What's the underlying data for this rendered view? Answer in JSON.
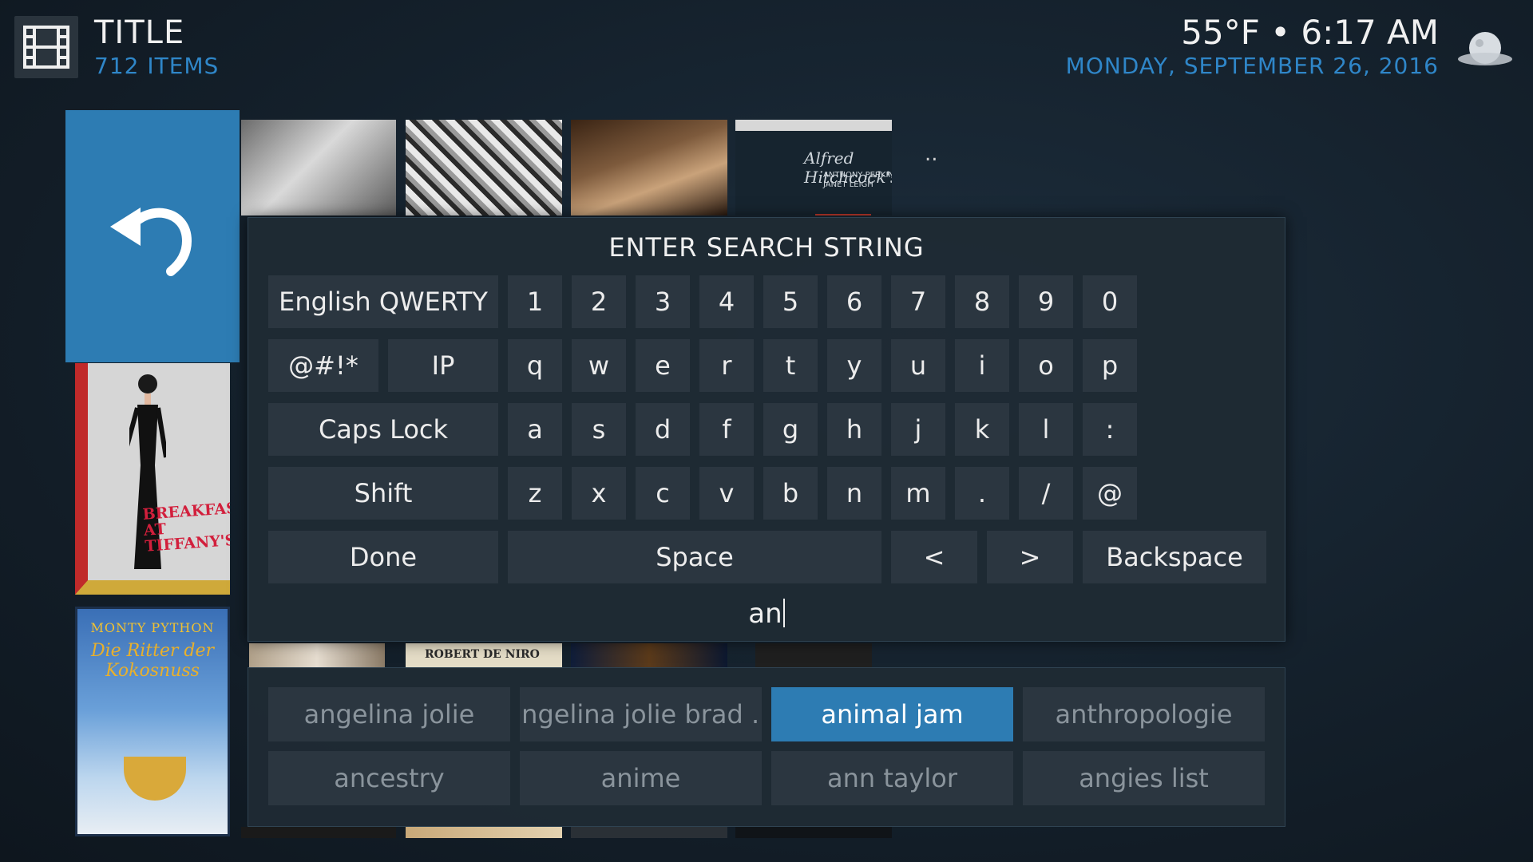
{
  "header": {
    "title": "TITLE",
    "item_count": "712 ITEMS",
    "weather": "55°F • 6:17 AM",
    "date": "MONDAY, SEPTEMBER 26, 2016"
  },
  "grid": {
    "parent_label": "..",
    "posters": [
      {
        "sig": "Alfred Hitchcock's",
        "names": "ANTHONY PERKINS\nJANET LEIGH"
      },
      {
        "title": "BREAKFAST AT TIFFANY'S"
      },
      {
        "title_top": "MONTY PYTHON",
        "title_main": "Die Ritter der Kokosnuss"
      },
      {
        "title": "ROBERT DE NIRO"
      }
    ]
  },
  "keyboard": {
    "title": "ENTER SEARCH STRING",
    "layout_label": "English QWERTY",
    "numbers": [
      "1",
      "2",
      "3",
      "4",
      "5",
      "6",
      "7",
      "8",
      "9",
      "0"
    ],
    "symbols_label": "@#!*",
    "ip_label": "IP",
    "row_q": [
      "q",
      "w",
      "e",
      "r",
      "t",
      "y",
      "u",
      "i",
      "o",
      "p"
    ],
    "caps_label": "Caps Lock",
    "row_a": [
      "a",
      "s",
      "d",
      "f",
      "g",
      "h",
      "j",
      "k",
      "l",
      ":"
    ],
    "shift_label": "Shift",
    "row_z": [
      "z",
      "x",
      "c",
      "v",
      "b",
      "n",
      "m",
      ".",
      "/",
      "@"
    ],
    "done_label": "Done",
    "space_label": "Space",
    "left_label": "<",
    "right_label": ">",
    "backspace_label": "Backspace",
    "input_value": "an"
  },
  "suggestions": {
    "items": [
      "angelina jolie",
      "angelina jolie brad ...",
      "animal jam",
      "anthropologie",
      "ancestry",
      "anime",
      "ann taylor",
      "angies list"
    ],
    "active_index": 2
  },
  "colors": {
    "accent": "#2d7cb3",
    "header_blue": "#2f86c8"
  }
}
